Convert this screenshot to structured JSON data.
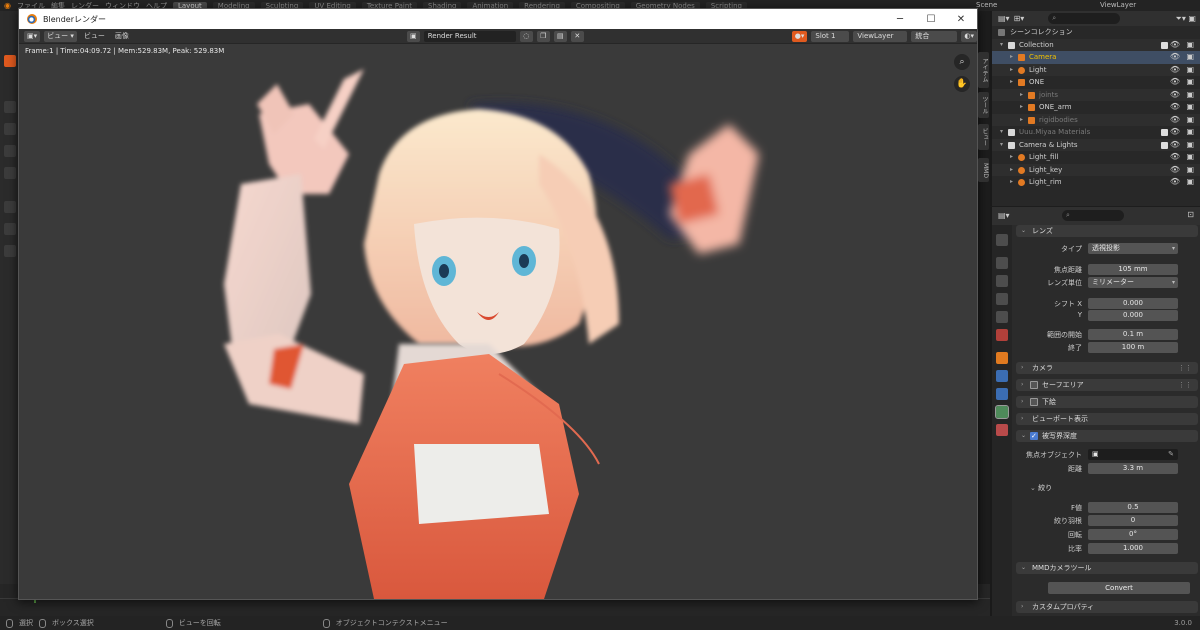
{
  "topbar": {
    "menus": [
      "ファイル",
      "編集",
      "レンダー",
      "ウィンドウ",
      "ヘルプ"
    ],
    "workspaces": [
      "Layout",
      "Modeling",
      "Sculpting",
      "UV Editing",
      "Texture Paint",
      "Shading",
      "Animation",
      "Rendering",
      "Compositing",
      "Geometry Nodes",
      "Scripting"
    ],
    "active_workspace": "Layout",
    "scene": "Scene",
    "view_layer": "ViewLayer"
  },
  "render_window": {
    "title": "Blenderレンダー",
    "menu_view": "ビュー",
    "menu_view2": "ビュー",
    "menu_image": "画像",
    "image_name": "Render Result",
    "slot": "Slot 1",
    "view_layer": "ViewLayer",
    "pass": "統合",
    "stats": "Frame:1 | Time:04:09.72 | Mem:529.83M, Peak: 529.83M"
  },
  "outliner": {
    "root": "シーンコレクション",
    "rows": [
      {
        "label": "Collection",
        "indent": 1,
        "icon": "collection",
        "color": "#cfcfcf"
      },
      {
        "label": "Camera",
        "indent": 2,
        "icon": "camera",
        "color": "#f0c000",
        "selected": true
      },
      {
        "label": "Light",
        "indent": 2,
        "icon": "light",
        "color": "#cfcfcf"
      },
      {
        "label": "ONE",
        "indent": 2,
        "icon": "armature",
        "color": "#cfcfcf"
      },
      {
        "label": "joints",
        "indent": 3,
        "icon": "armature",
        "color": "#7a7a7a"
      },
      {
        "label": "ONE_arm",
        "indent": 3,
        "icon": "armature",
        "color": "#cfcfcf"
      },
      {
        "label": "rigidbodies",
        "indent": 3,
        "icon": "armature",
        "color": "#7a7a7a"
      },
      {
        "label": "Uuu.Miyaa Materials",
        "indent": 1,
        "icon": "collection",
        "color": "#7a7a7a"
      },
      {
        "label": "Camera & Lights",
        "indent": 1,
        "icon": "collection",
        "color": "#cfcfcf"
      },
      {
        "label": "Light_fill",
        "indent": 2,
        "icon": "light",
        "color": "#cfcfcf"
      },
      {
        "label": "Light_key",
        "indent": 2,
        "icon": "light",
        "color": "#cfcfcf"
      },
      {
        "label": "Light_rim",
        "indent": 2,
        "icon": "light",
        "color": "#cfcfcf"
      }
    ]
  },
  "properties": {
    "lens_section": "レンズ",
    "type_label": "タイプ",
    "type_value": "透視投影",
    "focal_label": "焦点距離",
    "focal_value": "105 mm",
    "lens_unit_label": "レンズ単位",
    "lens_unit_value": "ミリメーター",
    "shift_x_label": "シフト X",
    "shift_x_value": "0.000",
    "shift_y_label": "Y",
    "shift_y_value": "0.000",
    "clip_start_label": "範囲の開始",
    "clip_start_value": "0.1 m",
    "clip_end_label": "終了",
    "clip_end_value": "100 m",
    "camera_section": "カメラ",
    "safe_areas_section": "セーフエリア",
    "background_section": "下絵",
    "viewport_section": "ビューポート表示",
    "dof_section": "被写界深度",
    "focus_object_label": "焦点オブジェクト",
    "distance_label": "距離",
    "distance_value": "3.3 m",
    "aperture_section": "絞り",
    "fstop_label": "F値",
    "fstop_value": "0.5",
    "blades_label": "絞り羽根",
    "blades_value": "0",
    "rotation_label": "回転",
    "rotation_value": "0°",
    "ratio_label": "比率",
    "ratio_value": "1.000",
    "mmd_section": "MMDカメラツール",
    "convert_button": "Convert",
    "custom_props_section": "カスタムプロパティ"
  },
  "side_tabs": [
    "アイテム",
    "ツール",
    "ビュー",
    "MMD"
  ],
  "statusbar": {
    "select": "選択",
    "box_select": "ボックス選択",
    "rotate_view": "ビューを回転",
    "context_menu": "オブジェクトコンテクストメニュー",
    "version": "3.0.0"
  },
  "colors": {
    "accent_blue": "#4b7bd0",
    "selected_row": "#3f4e64",
    "camera_label": "#f0c000",
    "active_tool": "#e05a1f"
  }
}
